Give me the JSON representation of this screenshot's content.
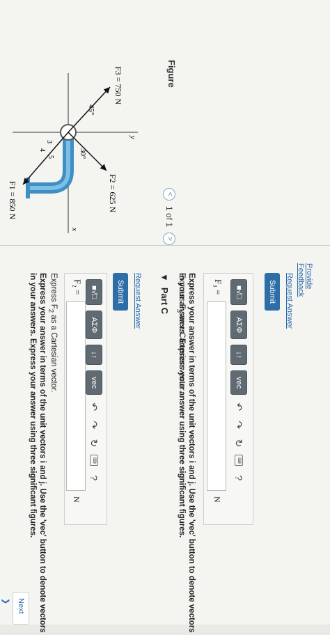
{
  "figure": {
    "title": "Figure",
    "pager": {
      "prev": "<",
      "count": "1 of 1",
      "next": ">"
    },
    "labels": {
      "f3": "F3 = 750 N",
      "f2": "F2 = 625 N",
      "f1": "F1 = 850 N",
      "angle45": "45°",
      "angle30": "30°",
      "y": "y",
      "x": "x",
      "three": "3",
      "four": "4",
      "five": "5"
    }
  },
  "part_b": {
    "line1_prefix": "Express F",
    "line1_sub": "2",
    "line1_suffix": " as a Cartesian vector.",
    "line2": "Express your answer in terms of the unit vectors i and j. Use the 'vec' button to denote vectors in your answers. Express your answer using three significant figures.",
    "var_label": "F₂ =",
    "unit": "N",
    "submit": "Submit",
    "request": "Request Answer"
  },
  "part_c": {
    "header": "Part C",
    "line1_prefix": "Express F",
    "line1_sub": "3",
    "line1_suffix": " as a Cartesian vector.",
    "line2": "Express your answer in terms of the unit vectors i and j. Use the 'vec' button to denote vectors in your answers. Express your answer using three significant figures.",
    "var_label": "F₃ =",
    "unit": "N",
    "submit": "Submit",
    "request": "Request Answer"
  },
  "toolbar": {
    "templates": "■√□",
    "greek": "ΑΣΦ",
    "arrows": "↓↑",
    "vec": "vec",
    "undo": "↶",
    "redo": "↷",
    "reset": "↻",
    "keyboard": "⌨",
    "help": "?"
  },
  "footer": {
    "provide_feedback": "Provide Feedback",
    "next": "Next ❯"
  }
}
